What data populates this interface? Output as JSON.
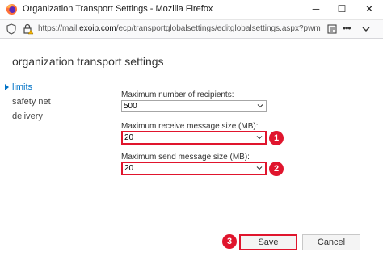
{
  "window": {
    "title": "Organization Transport Settings - Mozilla Firefox",
    "minimize": "─",
    "maximize": "☐",
    "close": "✕"
  },
  "urlbar": {
    "prefix": "https://mail.",
    "host": "exoip.com",
    "path": "/ecp/transportglobalsettings/editglobalsettings.aspx?pwmc",
    "more": "•••"
  },
  "page": {
    "title": "organization transport settings"
  },
  "nav": {
    "items": [
      {
        "label": "limits"
      },
      {
        "label": "safety net"
      },
      {
        "label": "delivery"
      }
    ]
  },
  "fields": {
    "max_recipients": {
      "label": "Maximum number of recipients:",
      "value": "500"
    },
    "max_receive": {
      "label": "Maximum receive message size (MB):",
      "value": "20"
    },
    "max_send": {
      "label": "Maximum send message size (MB):",
      "value": "20"
    }
  },
  "badges": [
    "1",
    "2",
    "3"
  ],
  "buttons": {
    "save": "Save",
    "cancel": "Cancel"
  },
  "colors": {
    "accent": "#0072c6",
    "annotation": "#e0152d"
  }
}
